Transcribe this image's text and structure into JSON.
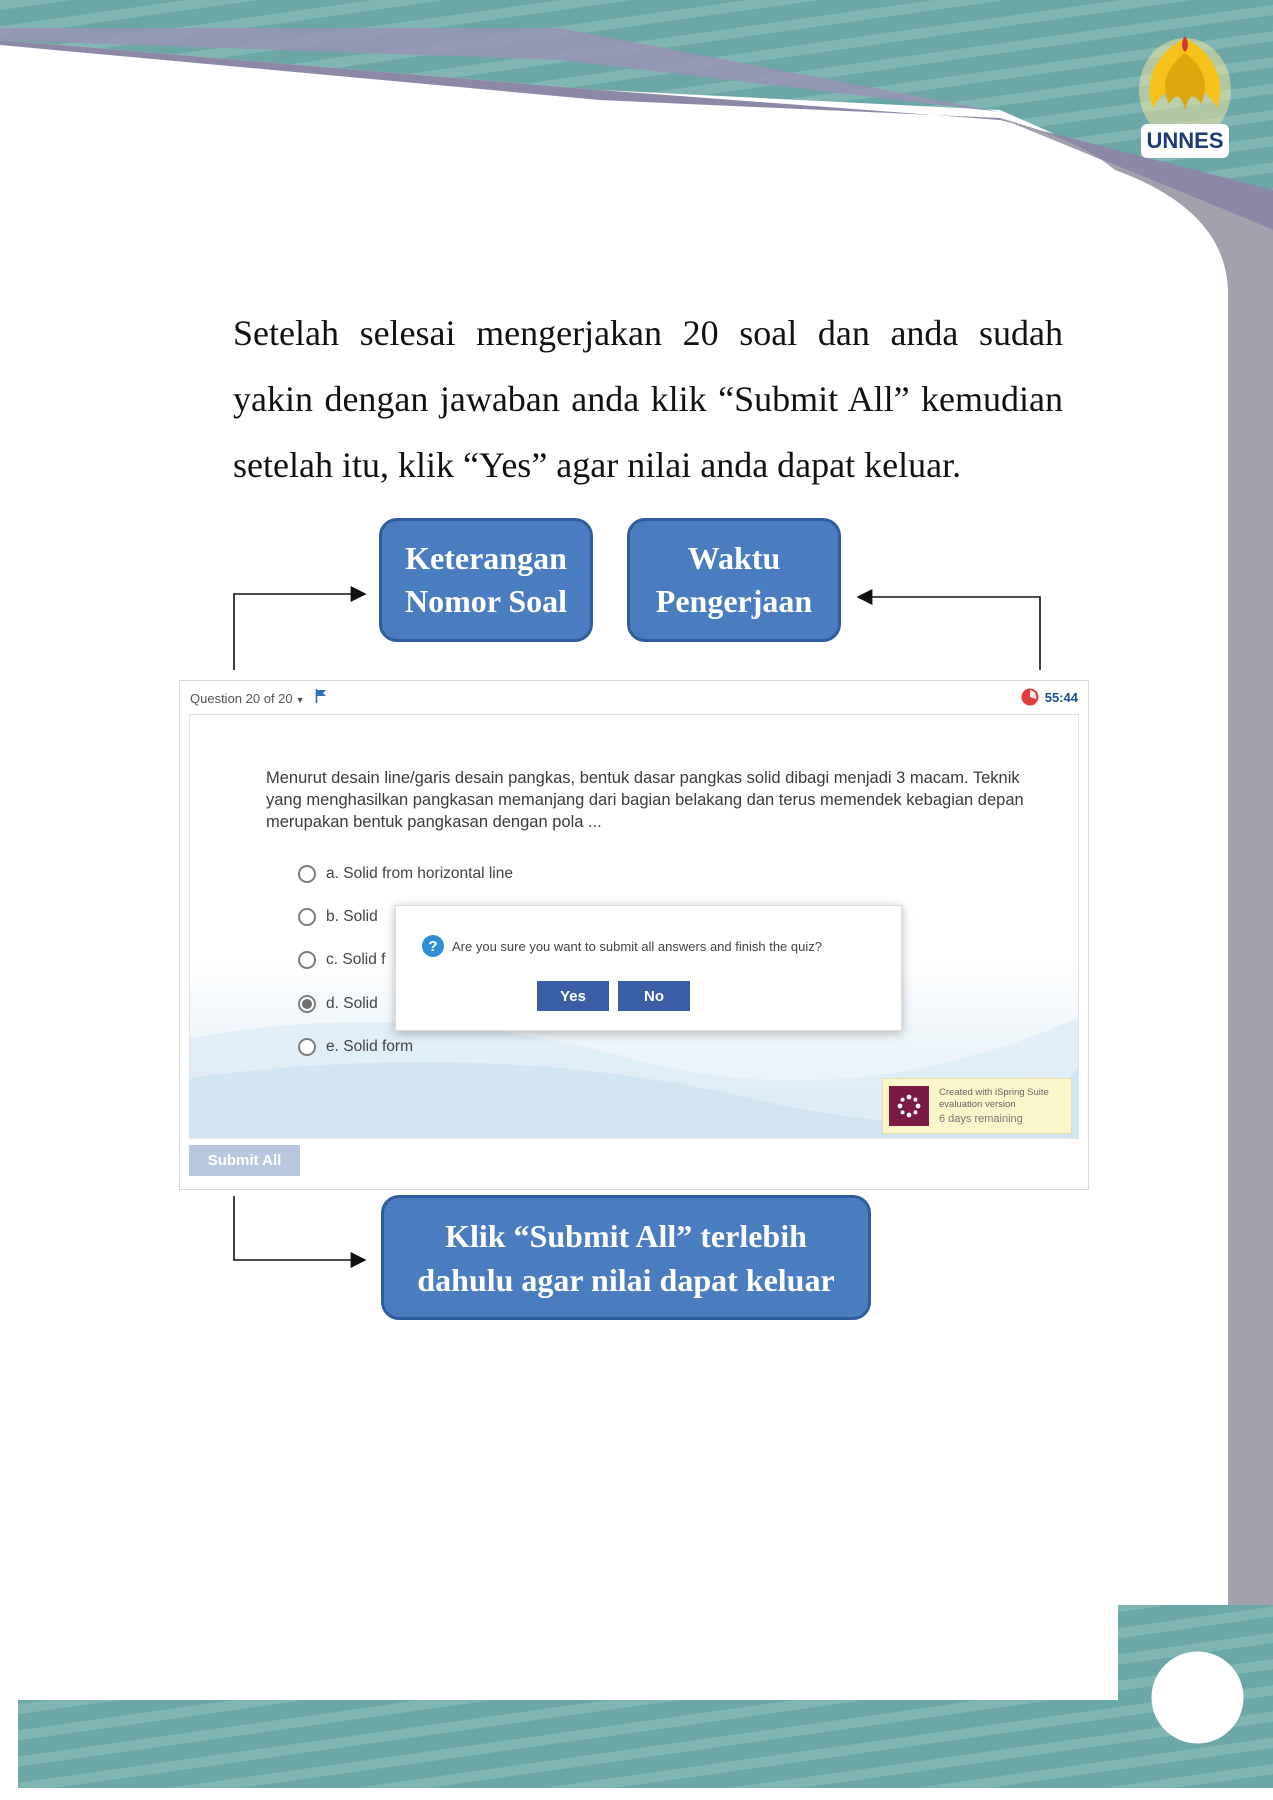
{
  "instruction": {
    "text": "Setelah selesai mengerjakan 20 soal dan anda sudah yakin dengan jawaban anda klik “Submit All” kemudian setelah itu, klik “Yes” agar nilai anda dapat keluar."
  },
  "logo": {
    "text": "UNNES"
  },
  "callouts": {
    "question_number": {
      "line1": "Keterangan",
      "line2": "Nomor Soal"
    },
    "time": {
      "line1": "Waktu",
      "line2": "Pengerjaan"
    },
    "submit": {
      "line1": "Klik “Submit All” terlebih",
      "line2": "dahulu agar nilai dapat keluar"
    }
  },
  "quiz": {
    "question_label": "Question 20 of 20",
    "timer": "55:44",
    "question_text": "Menurut desain line/garis desain pangkas, bentuk dasar pangkas solid dibagi menjadi 3 macam. Teknik yang menghasilkan pangkasan memanjang dari bagian belakang dan terus memendek kebagian depan merupakan bentuk pangkasan dengan pola ...",
    "options": [
      {
        "label": "a. Solid from horizontal line",
        "selected": false
      },
      {
        "label": "b. Solid",
        "selected": false
      },
      {
        "label": "c. Solid f",
        "selected": false
      },
      {
        "label": "d. Solid",
        "selected": true
      },
      {
        "label": "e. Solid form",
        "selected": false
      }
    ],
    "dialog": {
      "message": "Are you sure you want to submit all answers and finish the quiz?",
      "yes_label": "Yes",
      "no_label": "No"
    },
    "ispring": {
      "line1": "Created with iSpring Suite",
      "line2": "evaluation version",
      "line3": "6 days remaining"
    },
    "submit_label": "Submit All"
  },
  "colors": {
    "callout_fill": "#4a7cc0",
    "dialog_button": "#3a5fa6",
    "teal_band": "#6aa7a6",
    "purple_band": "#8c88a8",
    "gray_side": "#a3a0ad"
  }
}
